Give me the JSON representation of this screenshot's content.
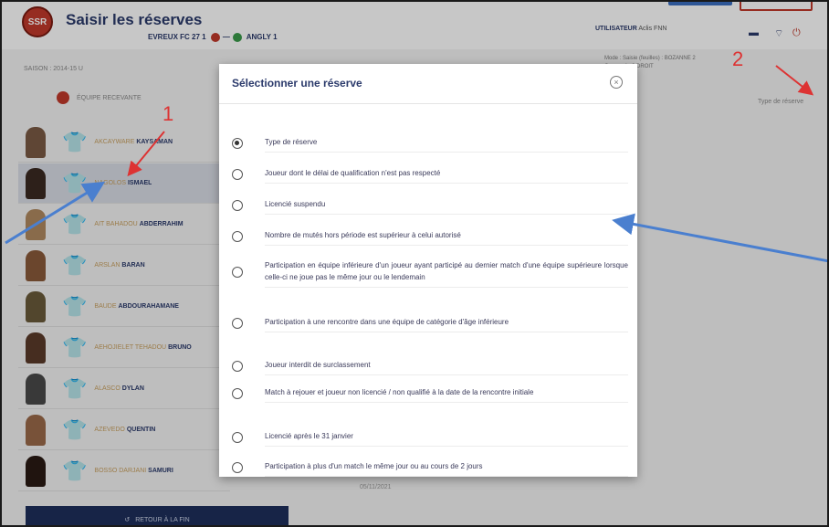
{
  "header": {
    "logo_text": "SSR",
    "title": "Saisir les réserves",
    "match_home": "EVREUX FC 27 1",
    "match_sep": "—",
    "match_away": "ANGLY 1",
    "season": "SAISON : 2014-15 U",
    "user_prefix": "UTILISATEUR",
    "user_name": "Aclis FNN",
    "meta_line1": "Mode : Saisie (feuilles) : BOZANNE 2",
    "meta_line2": "Groupe 4 : 2 DROIT",
    "icons": [
      "monitor-icon",
      "wifi-icon",
      "power-icon"
    ]
  },
  "list": {
    "team_header": "ÉQUIPE RECEVANTE",
    "type_column": "Type de réserve",
    "players": [
      {
        "first": "AKCAYWARE",
        "last": "KAYSAMAN"
      },
      {
        "first": "NAGOLOS",
        "last": "ISMAEL"
      },
      {
        "first": "AIT BAHADOU",
        "last": "ABDERRAHIM"
      },
      {
        "first": "ARSLAN",
        "last": "BARAN"
      },
      {
        "first": "BAUDE",
        "last": "ABDOURAHAMANE"
      },
      {
        "first": "AEHOJIELET TEHADOU",
        "last": "BRUNO"
      },
      {
        "first": "ALASCO",
        "last": "DYLAN"
      },
      {
        "first": "AZEVEDO",
        "last": "QUENTIN"
      },
      {
        "first": "BOSSO DARJANI",
        "last": "SAMURI"
      }
    ],
    "bottom_date": "05/11/2021",
    "back_button": "RETOUR À LA FIN"
  },
  "modal": {
    "title": "Sélectionner une réserve",
    "options": [
      {
        "label": "Type de réserve",
        "checked": true
      },
      {
        "label": "Joueur dont le délai de qualification n'est pas respecté",
        "checked": false
      },
      {
        "label": "Licencié suspendu",
        "checked": false
      },
      {
        "label": "Nombre de mutés hors période est supérieur à celui autorisé",
        "checked": false
      },
      {
        "label": "Participation en équipe inférieure d'un joueur ayant participé au dernier match d'une équipe supérieure lorsque celle-ci ne joue pas le même jour ou le lendemain",
        "checked": false
      },
      {
        "label": "Participation à une rencontre dans une équipe de catégorie d'âge inférieure",
        "checked": false
      },
      {
        "label": "Joueur interdit de surclassement",
        "checked": false
      },
      {
        "label": "Match à rejouer et joueur non licencié / non qualifié à la date de la rencontre initiale",
        "checked": false
      },
      {
        "label": "Licencié après le 31 janvier",
        "checked": false
      },
      {
        "label": "Participation à plus d'un match le même jour ou au cours de 2 jours",
        "checked": false
      }
    ]
  },
  "annotations": {
    "label_1": "1",
    "label_2": "2",
    "red_color": "#dd3333",
    "blue_color": "#4a7fcf"
  }
}
